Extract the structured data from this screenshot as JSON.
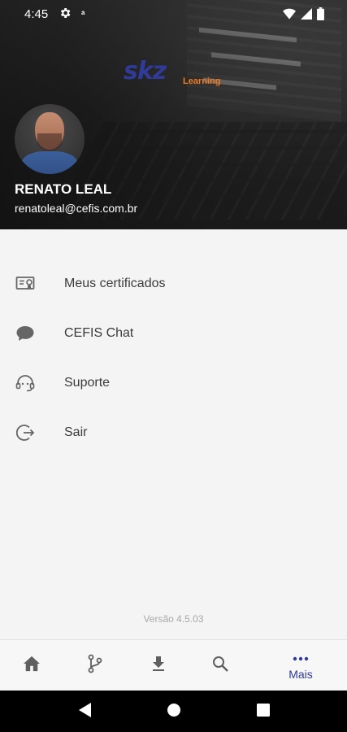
{
  "status_bar": {
    "time": "4:45",
    "notification_letter": "a",
    "icons": [
      "gear-icon",
      "wifi-icon",
      "signal-icon",
      "battery-icon"
    ]
  },
  "header": {
    "logo_main": "skz",
    "logo_sub": "Learning",
    "user_name": "RENATO LEAL",
    "user_email": "renatoleal@cefis.com.br"
  },
  "menu": {
    "items": [
      {
        "label": "Meus certificados",
        "icon": "certificate-icon"
      },
      {
        "label": "CEFIS Chat",
        "icon": "chat-icon"
      },
      {
        "label": "Suporte",
        "icon": "support-icon"
      },
      {
        "label": "Sair",
        "icon": "logout-icon"
      }
    ]
  },
  "version": "Versão 4.5.03",
  "bottom_nav": {
    "items": [
      {
        "icon": "home-icon",
        "label": ""
      },
      {
        "icon": "branch-icon",
        "label": ""
      },
      {
        "icon": "download-icon",
        "label": ""
      },
      {
        "icon": "search-icon",
        "label": ""
      },
      {
        "icon": "more-icon",
        "label": "Mais"
      }
    ],
    "active_color": "#2f3b97",
    "inactive_color": "#6b6b6b"
  },
  "colors": {
    "brand_blue": "#2f3b97",
    "brand_orange": "#f07b20"
  }
}
